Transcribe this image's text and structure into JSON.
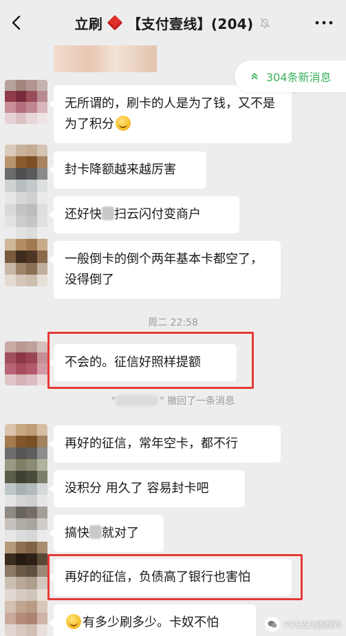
{
  "header": {
    "title_prefix": "立刷",
    "title_main": "【支付壹线】(204)"
  },
  "banner": {
    "new_messages": "304条新消息"
  },
  "messages": [
    {
      "text": "无所谓的，刷卡的人是为了钱，又不是为了积分"
    },
    {
      "text": "封卡降额越来越厉害"
    },
    {
      "text_before": "还好快",
      "text_after": "扫云闪付变商户"
    },
    {
      "text": "一般倒卡的倒个两年基本卡都空了，没得倒了"
    },
    {
      "text": "不会的。征信好照样提额"
    },
    {
      "text": "再好的征信，常年空卡，都不行"
    },
    {
      "text": "没积分 用久了  容易封卡吧"
    },
    {
      "text_before": "搞快",
      "text_after": "就对了"
    },
    {
      "text": "再好的征信，负债高了银行也害怕"
    },
    {
      "text": "有多少刷多少。卡奴不怕"
    }
  ],
  "system": {
    "timestamp": "周二 22:58",
    "recall_suffix": "\" 撤回了一条消息",
    "recall_prefix": "\""
  },
  "watermark": {
    "text": "POS支付圈爆料"
  },
  "colors": {
    "background": "#ededed",
    "bubble": "#ffffff",
    "accent_green": "#3ab15a",
    "highlight_red": "#e53935",
    "diamond_red": "#e0312a"
  }
}
